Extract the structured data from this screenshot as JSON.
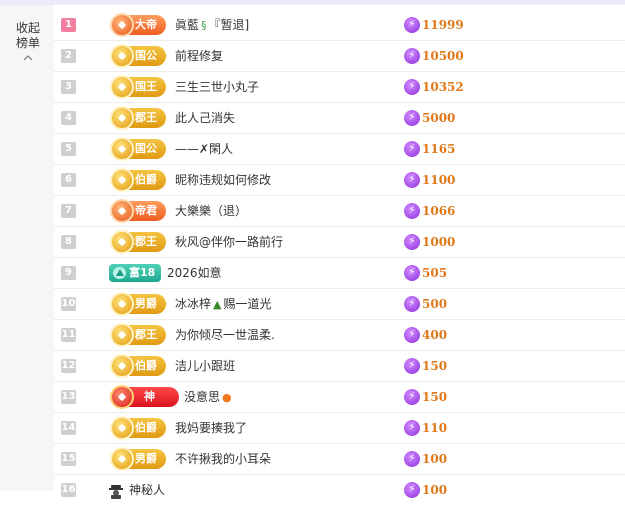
{
  "sidebar": {
    "collapse_label_line1": "收起",
    "collapse_label_line2": "榜单"
  },
  "currency_icon": "lightning-coin-icon",
  "colors": {
    "value_text": "#e0781a",
    "rank_top": "#f37fa0",
    "rank_default": "#cfcfcf"
  },
  "rows": [
    {
      "rank": "1",
      "badge": "大帝",
      "badge_style": "orange",
      "name": "眞藍",
      "name_suffix": "『暂退]",
      "suffix_icon": "dragon-icon",
      "value": "11999"
    },
    {
      "rank": "2",
      "badge": "国公",
      "badge_style": "gold",
      "name": "前程修复",
      "value": "10500"
    },
    {
      "rank": "3",
      "badge": "国王",
      "badge_style": "gold",
      "name": "三生三世小丸子",
      "value": "10352"
    },
    {
      "rank": "4",
      "badge": "郡王",
      "badge_style": "gold",
      "name": "此人己消失",
      "value": "5000"
    },
    {
      "rank": "5",
      "badge": "国公",
      "badge_style": "gold",
      "name": "——✗閑人",
      "value": "1165"
    },
    {
      "rank": "6",
      "badge": "伯爵",
      "badge_style": "gold",
      "name": "昵称违规如何修改",
      "value": "1100"
    },
    {
      "rank": "7",
      "badge": "帝君",
      "badge_style": "orange",
      "name": "大樂樂（退）",
      "value": "1066"
    },
    {
      "rank": "8",
      "badge": "郡王",
      "badge_style": "gold",
      "name": "秋风@伴你一路前行",
      "value": "1000"
    },
    {
      "rank": "9",
      "badge": "富18",
      "badge_style": "green",
      "name": "2026如意",
      "value": "505"
    },
    {
      "rank": "10",
      "badge": "男爵",
      "badge_style": "gold",
      "name": "冰冰梓",
      "name_suffix": "赐一道光",
      "suffix_icon": "tree-icon",
      "value": "500"
    },
    {
      "rank": "11",
      "badge": "郡王",
      "badge_style": "gold",
      "name": "为你倾尽一世温柔.",
      "value": "400"
    },
    {
      "rank": "12",
      "badge": "伯爵",
      "badge_style": "gold",
      "name": "洁儿小跟班",
      "value": "150"
    },
    {
      "rank": "13",
      "badge": "神",
      "badge_style": "red",
      "name": "没意思",
      "suffix_icon": "fire-icon",
      "value": "150"
    },
    {
      "rank": "14",
      "badge": "伯爵",
      "badge_style": "gold",
      "name": "我妈要揍我了",
      "value": "110"
    },
    {
      "rank": "15",
      "badge": "男爵",
      "badge_style": "gold",
      "name": "不许揪我的小耳朵",
      "value": "100"
    },
    {
      "rank": "16",
      "badge": "",
      "badge_style": "mystery",
      "name": "神秘人",
      "value": "100"
    }
  ]
}
